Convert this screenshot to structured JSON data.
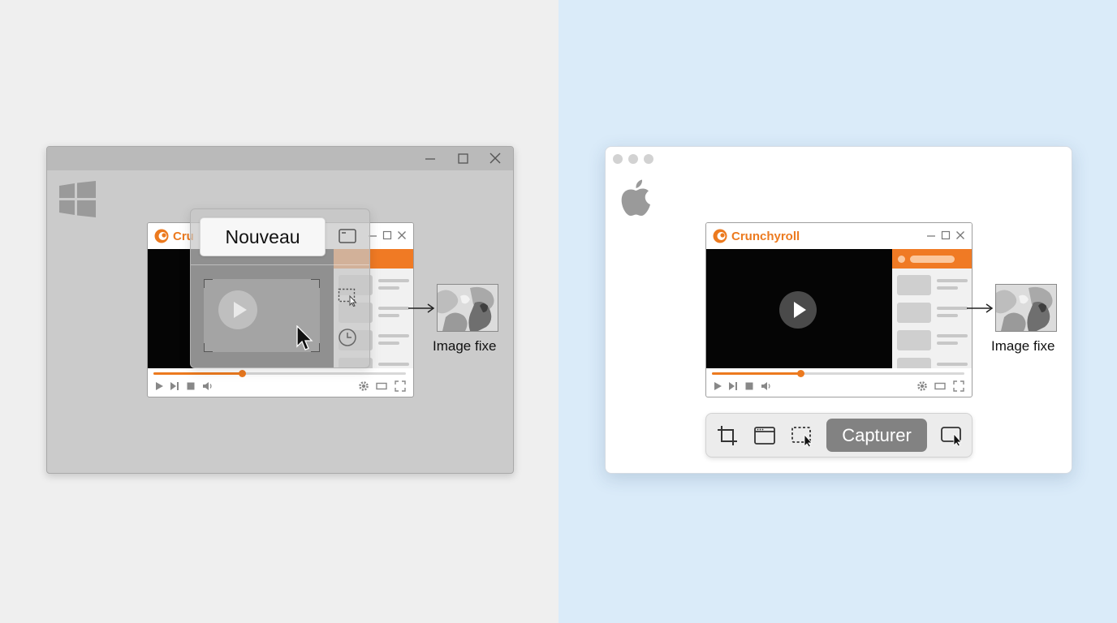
{
  "windows_panel": {
    "os_logo": "windows-logo",
    "window_controls": [
      "minimize-icon",
      "maximize-icon",
      "close-icon"
    ],
    "player": {
      "brand": "Cru",
      "progress_fraction": 0.35
    },
    "snipping_tool": {
      "new_button_label": "Nouveau",
      "icons": [
        "window-mode-icon",
        "rectangle-snip-icon",
        "delay-clock-icon"
      ]
    },
    "output": {
      "label": "Image fixe"
    }
  },
  "mac_panel": {
    "os_logo": "apple-logo",
    "player": {
      "brand": "Crunchyroll",
      "progress_fraction": 0.35
    },
    "toolbar": {
      "icons": [
        "crop-icon",
        "window-capture-icon",
        "selection-capture-icon",
        "screen-record-icon"
      ],
      "capture_label": "Capturer"
    },
    "output": {
      "label": "Image fixe"
    }
  },
  "colors": {
    "crunchyroll_orange": "#ec7a1f",
    "left_background": "#efefef",
    "right_background": "#daebf9"
  }
}
